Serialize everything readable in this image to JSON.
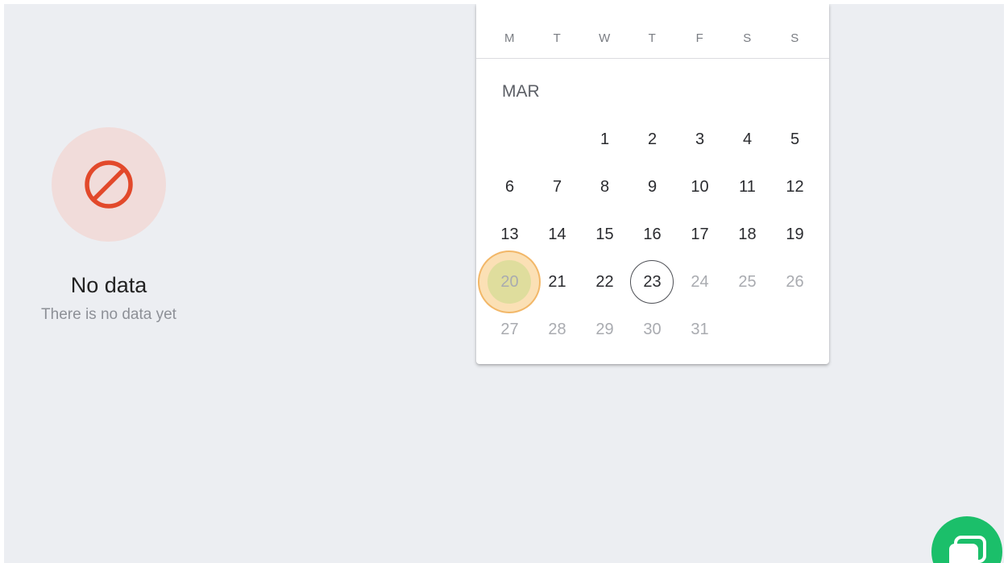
{
  "empty_state": {
    "icon": "no-entry-icon",
    "title": "No data",
    "subtitle": "There is no data yet"
  },
  "calendar": {
    "weekdays": [
      "M",
      "T",
      "W",
      "T",
      "F",
      "S",
      "S"
    ],
    "month_label": "MAR",
    "today": 23,
    "highlighted": 20,
    "days": [
      {
        "label": "",
        "muted": false
      },
      {
        "label": "",
        "muted": false
      },
      {
        "label": "1",
        "muted": false
      },
      {
        "label": "2",
        "muted": false
      },
      {
        "label": "3",
        "muted": false
      },
      {
        "label": "4",
        "muted": false
      },
      {
        "label": "5",
        "muted": false
      },
      {
        "label": "6",
        "muted": false
      },
      {
        "label": "7",
        "muted": false
      },
      {
        "label": "8",
        "muted": false
      },
      {
        "label": "9",
        "muted": false
      },
      {
        "label": "10",
        "muted": false
      },
      {
        "label": "11",
        "muted": false
      },
      {
        "label": "12",
        "muted": false
      },
      {
        "label": "13",
        "muted": false
      },
      {
        "label": "14",
        "muted": false
      },
      {
        "label": "15",
        "muted": false
      },
      {
        "label": "16",
        "muted": false
      },
      {
        "label": "17",
        "muted": false
      },
      {
        "label": "18",
        "muted": false
      },
      {
        "label": "19",
        "muted": false
      },
      {
        "label": "20",
        "muted": true
      },
      {
        "label": "21",
        "muted": false
      },
      {
        "label": "22",
        "muted": false
      },
      {
        "label": "23",
        "muted": false
      },
      {
        "label": "24",
        "muted": true
      },
      {
        "label": "25",
        "muted": true
      },
      {
        "label": "26",
        "muted": true
      },
      {
        "label": "27",
        "muted": true
      },
      {
        "label": "28",
        "muted": true
      },
      {
        "label": "29",
        "muted": true
      },
      {
        "label": "30",
        "muted": true
      },
      {
        "label": "31",
        "muted": true
      }
    ]
  },
  "chat_button": {
    "icon": "chat-bubble-icon"
  },
  "colors": {
    "background": "#eceef2",
    "error_accent": "#e2492b",
    "error_bg": "#f1dcda",
    "fab": "#1bbf6a",
    "highlight": "#f2b260"
  }
}
